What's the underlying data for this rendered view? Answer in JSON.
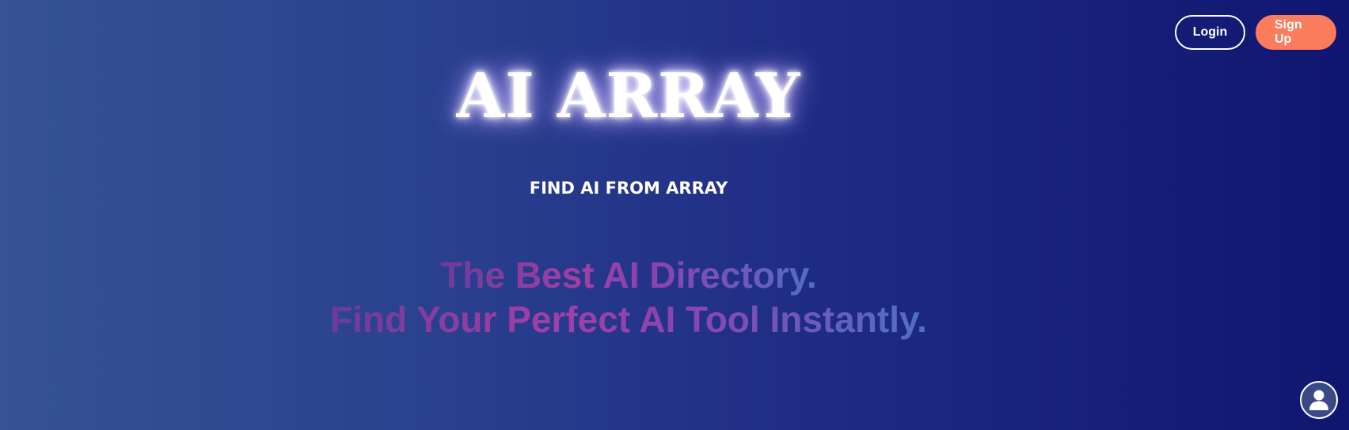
{
  "header": {
    "login_label": "Login",
    "signup_label": "Sign Up",
    "signup_color": "#fb7b5d"
  },
  "hero": {
    "title": "AI ARRAY",
    "tagline": "FIND AI FROM ARRAY",
    "headline_line1": "The Best AI Directory.",
    "headline_line2": "Find Your Perfect AI Tool Instantly."
  },
  "profile": {
    "icon": "user-icon"
  },
  "colors": {
    "background_start": "#365394",
    "background_end": "#0f1670",
    "headline_gradient": [
      "#6d3b99",
      "#a23ea6",
      "#4f6fc9"
    ]
  }
}
